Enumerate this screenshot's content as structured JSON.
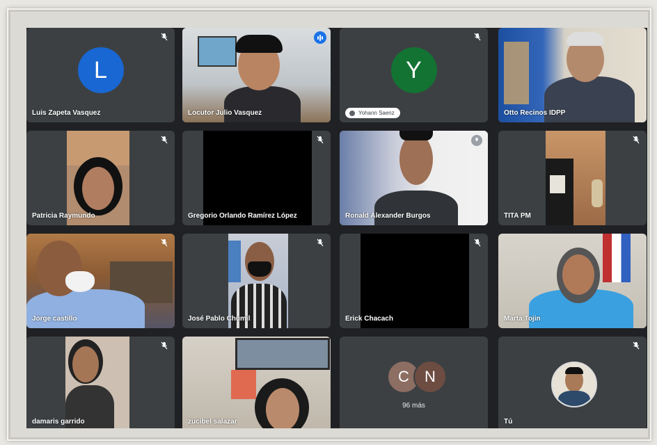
{
  "participants": [
    {
      "name": "Luis Zapeta Vasquez",
      "initial": "L",
      "avatar_color": "#1967d2"
    },
    {
      "name": "Locutor Julio Vasquez"
    },
    {
      "name": "Yohann Saenz",
      "initial": "Y",
      "avatar_color": "#137333"
    },
    {
      "name": "Otto Recinos IDPP"
    },
    {
      "name": "Patricia Raymundo"
    },
    {
      "name": "Gregorio Orlando Ramírez López"
    },
    {
      "name": "Ronald Alexander Burgos"
    },
    {
      "name": "TITA PM"
    },
    {
      "name": "Jorge castillo"
    },
    {
      "name": "José Pablo Chumil"
    },
    {
      "name": "Erick Chacach"
    },
    {
      "name": "Marta Tojin"
    },
    {
      "name": "damaris garrido"
    },
    {
      "name": "zucibel salazar"
    }
  ],
  "overflow": {
    "initials": [
      "C",
      "N"
    ],
    "colors": [
      "#8d6e63",
      "#6d4c41"
    ],
    "label": "96 más"
  },
  "self": {
    "name": "Tú"
  },
  "colors": {
    "tile": "#3c4043",
    "background": "#202124",
    "speaking_accent": "#1a73e8"
  }
}
